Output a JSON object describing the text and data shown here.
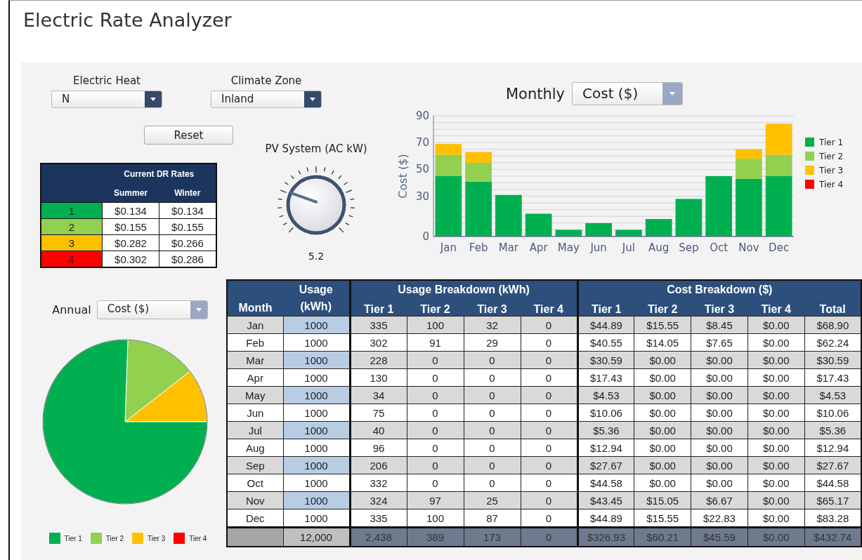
{
  "title": "Electric Rate Analyzer",
  "controls": {
    "electric_heat": {
      "label": "Electric Heat",
      "value": "N"
    },
    "climate_zone": {
      "label": "Climate Zone",
      "value": "Inland"
    },
    "reset_button": "Reset"
  },
  "dr_rates": {
    "title": "Current DR Rates",
    "columns": [
      "Summer",
      "Winter"
    ],
    "rows": [
      {
        "tier": "1",
        "color": "#00b050",
        "summer": "$0.134",
        "winter": "$0.134"
      },
      {
        "tier": "2",
        "color": "#92d050",
        "summer": "$0.155",
        "winter": "$0.155"
      },
      {
        "tier": "3",
        "color": "#ffc000",
        "summer": "$0.282",
        "winter": "$0.266"
      },
      {
        "tier": "4",
        "color": "#ff0000",
        "summer": "$0.302",
        "winter": "$0.286"
      }
    ]
  },
  "pv_system": {
    "label": "PV System (AC kW)",
    "level": 0.26,
    "reading": "5.2"
  },
  "monthly_chart": {
    "label": "Monthly",
    "selector": "Cost ($)",
    "chart_data": {
      "type": "bar",
      "stacked": true,
      "grid": true,
      "legend": true,
      "ylabel": "Cost ($)",
      "ylim": [
        0,
        90
      ],
      "yticks": [
        0,
        30,
        50,
        70,
        90
      ],
      "categories": [
        "Jan",
        "Feb",
        "Mar",
        "Apr",
        "May",
        "Jun",
        "Jul",
        "Aug",
        "Sep",
        "Oct",
        "Nov",
        "Dec"
      ],
      "series": [
        {
          "name": "Tier 1",
          "color": "#00b050",
          "values": [
            45,
            41,
            31,
            17,
            5,
            10,
            5,
            13,
            28,
            45,
            43,
            45
          ]
        },
        {
          "name": "Tier 2",
          "color": "#92d050",
          "values": [
            16,
            14,
            0,
            0,
            0,
            0,
            0,
            0,
            0,
            0,
            15,
            16
          ]
        },
        {
          "name": "Tier 3",
          "color": "#ffc000",
          "values": [
            8,
            8,
            0,
            0,
            0,
            0,
            0,
            0,
            0,
            0,
            7,
            23
          ]
        },
        {
          "name": "Tier 4",
          "color": "#ff0000",
          "values": [
            0,
            0,
            0,
            0,
            0,
            0,
            0,
            0,
            0,
            0,
            0,
            0
          ]
        }
      ]
    }
  },
  "annual_chart": {
    "label": "Annual",
    "selector": "Cost ($)",
    "legend": [
      {
        "label": "Tier 1",
        "color": "#00b050"
      },
      {
        "label": "Tier 2",
        "color": "#92d050"
      },
      {
        "label": "Tier 3",
        "color": "#ffc000"
      },
      {
        "label": "Tier 4",
        "color": "#ff0000"
      }
    ],
    "chart_data": {
      "type": "pie",
      "values": [
        75.55,
        13.91,
        10.54,
        0
      ]
    }
  },
  "table": {
    "month_header": "Month",
    "usage_header": "Usage (kWh)",
    "groups": [
      "Usage Breakdown (kWh)",
      "Cost Breakdown ($)"
    ],
    "sub_columns": [
      "Tier 1",
      "Tier 2",
      "Tier 3",
      "Tier 4",
      "Tier 1",
      "Tier 2",
      "Tier 3",
      "Tier 4",
      "Total"
    ],
    "rows": [
      {
        "month": "Jan",
        "usage": "1000",
        "kwh": [
          "335",
          "100",
          "32",
          "0"
        ],
        "cost": [
          "$44.89",
          "$15.55",
          "$8.45",
          "$0.00",
          "$68.90"
        ]
      },
      {
        "month": "Feb",
        "usage": "1000",
        "kwh": [
          "302",
          "91",
          "29",
          "0"
        ],
        "cost": [
          "$40.55",
          "$14.05",
          "$7.65",
          "$0.00",
          "$62.24"
        ]
      },
      {
        "month": "Mar",
        "usage": "1000",
        "kwh": [
          "228",
          "0",
          "0",
          "0"
        ],
        "cost": [
          "$30.59",
          "$0.00",
          "$0.00",
          "$0.00",
          "$30.59"
        ]
      },
      {
        "month": "Apr",
        "usage": "1000",
        "kwh": [
          "130",
          "0",
          "0",
          "0"
        ],
        "cost": [
          "$17.43",
          "$0.00",
          "$0.00",
          "$0.00",
          "$17.43"
        ]
      },
      {
        "month": "May",
        "usage": "1000",
        "kwh": [
          "34",
          "0",
          "0",
          "0"
        ],
        "cost": [
          "$4.53",
          "$0.00",
          "$0.00",
          "$0.00",
          "$4.53"
        ]
      },
      {
        "month": "Jun",
        "usage": "1000",
        "kwh": [
          "75",
          "0",
          "0",
          "0"
        ],
        "cost": [
          "$10.06",
          "$0.00",
          "$0.00",
          "$0.00",
          "$10.06"
        ]
      },
      {
        "month": "Jul",
        "usage": "1000",
        "kwh": [
          "40",
          "0",
          "0",
          "0"
        ],
        "cost": [
          "$5.36",
          "$0.00",
          "$0.00",
          "$0.00",
          "$5.36"
        ]
      },
      {
        "month": "Aug",
        "usage": "1000",
        "kwh": [
          "96",
          "0",
          "0",
          "0"
        ],
        "cost": [
          "$12.94",
          "$0.00",
          "$0.00",
          "$0.00",
          "$12.94"
        ]
      },
      {
        "month": "Sep",
        "usage": "1000",
        "kwh": [
          "206",
          "0",
          "0",
          "0"
        ],
        "cost": [
          "$27.67",
          "$0.00",
          "$0.00",
          "$0.00",
          "$27.67"
        ]
      },
      {
        "month": "Oct",
        "usage": "1000",
        "kwh": [
          "332",
          "0",
          "0",
          "0"
        ],
        "cost": [
          "$44.58",
          "$0.00",
          "$0.00",
          "$0.00",
          "$44.58"
        ]
      },
      {
        "month": "Nov",
        "usage": "1000",
        "kwh": [
          "324",
          "97",
          "25",
          "0"
        ],
        "cost": [
          "$43.45",
          "$15.05",
          "$6.67",
          "$0.00",
          "$65.17"
        ]
      },
      {
        "month": "Dec",
        "usage": "1000",
        "kwh": [
          "335",
          "100",
          "87",
          "0"
        ],
        "cost": [
          "$44.89",
          "$15.55",
          "$22.83",
          "$0.00",
          "$83.28"
        ]
      }
    ],
    "totals": {
      "usage": "12,000",
      "kwh": [
        "2,438",
        "389",
        "173",
        "0"
      ],
      "cost": [
        "$326.93",
        "$60.21",
        "$45.59",
        "$0.00",
        "$432.74"
      ]
    }
  }
}
